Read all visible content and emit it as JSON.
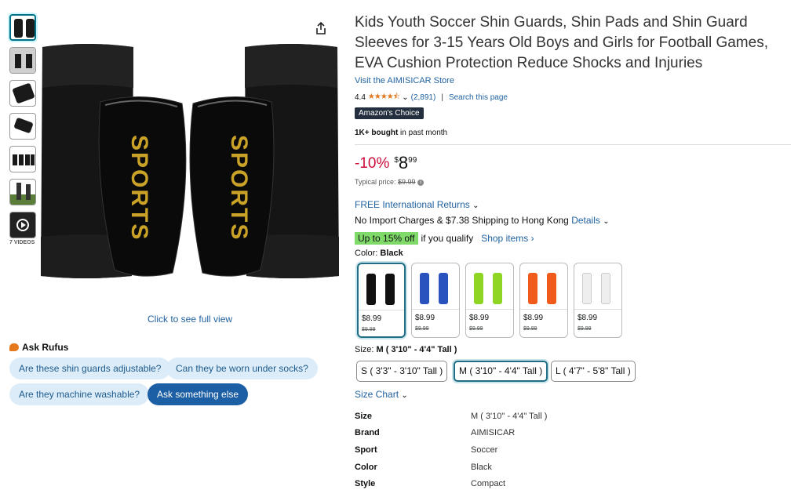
{
  "thumbnails": {
    "videos_label": "7 VIDEOS"
  },
  "gallery": {
    "click_full_view": "Click to see full view",
    "shin_text": "SPORTS"
  },
  "rufus": {
    "title": "Ask Rufus",
    "chips": [
      "Are these shin guards adjustable?",
      "Can they be worn under socks?",
      "Are they machine washable?",
      "Ask something else"
    ]
  },
  "product": {
    "title": "Kids Youth Soccer Shin Guards, Shin Pads and Shin Guard Sleeves for 3-15 Years Old Boys and Girls for Football Games, EVA Cushion Protection Reduce Shocks and Injuries",
    "store": "Visit the AIMISICAR Store",
    "rating_value": "4.4",
    "rating_count": "(2,891)",
    "search_page": "Search this page",
    "badge": "Amazon's Choice",
    "bought_bold": "1K+ bought",
    "bought_rest": " in past month"
  },
  "price": {
    "discount": "-10%",
    "currency": "$",
    "whole": "8",
    "fraction": "99",
    "typical_label": "Typical price: ",
    "typical_value": "$9.99"
  },
  "delivery": {
    "returns": "FREE International Returns",
    "shipping": "No Import Charges & $7.38 Shipping to Hong Kong",
    "details": "Details"
  },
  "promo": {
    "tag": "Up to 15% off",
    "text": "if you qualify",
    "link": "Shop items ›"
  },
  "color": {
    "label": "Color: ",
    "selected": "Black",
    "options": [
      {
        "price": "$8.99",
        "was": "$9.99",
        "color": "#111111",
        "accent": "#c9a227"
      },
      {
        "price": "$8.99",
        "was": "$9.99",
        "color": "#2a52be",
        "accent": "#ffffff"
      },
      {
        "price": "$8.99",
        "was": "$9.99",
        "color": "#8fd624",
        "accent": "#ffffff"
      },
      {
        "price": "$8.99",
        "was": "$9.99",
        "color": "#f05a1a",
        "accent": "#ffffff"
      },
      {
        "price": "$8.99",
        "was": "$9.99",
        "color": "#eeeeee",
        "accent": "#999999"
      }
    ]
  },
  "size": {
    "label": "Size: ",
    "selected": "M ( 3'10\" - 4'4\" Tall )",
    "options": [
      "S ( 3'3\" - 3'10\" Tall )",
      "M ( 3'10\" - 4'4\" Tall )",
      "L ( 4'7\" - 5'8\" Tall )"
    ],
    "chart": "Size Chart"
  },
  "specs": [
    {
      "k": "Size",
      "v": "M ( 3'10\" - 4'4\" Tall )"
    },
    {
      "k": "Brand",
      "v": "AIMISICAR"
    },
    {
      "k": "Sport",
      "v": "Soccer"
    },
    {
      "k": "Color",
      "v": "Black"
    },
    {
      "k": "Style",
      "v": "Compact"
    }
  ]
}
